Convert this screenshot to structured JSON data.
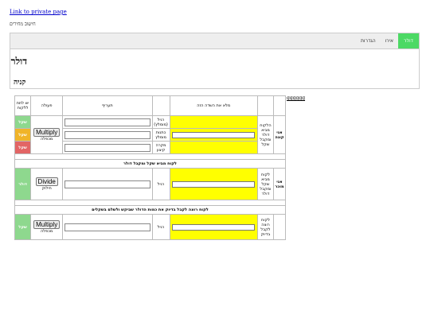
{
  "link_text": "Link to private page",
  "calc_title": "חישוב מחירים",
  "tabs": {
    "dollar": "דולר",
    "euro": "אירו",
    "settings": "הגדרות"
  },
  "panel": {
    "title": "דולר",
    "subtitle": "קניה"
  },
  "extra_link": "gggggg",
  "table": {
    "headers": {
      "enter": "מלא את השדה הזה",
      "desc": "תעריף",
      "action": "פעולה",
      "has": "יש לתת ללקוח"
    },
    "buy": {
      "role": "אני קונה",
      "client": "הלקוח מביא דולר ומקבל שקל",
      "rows": [
        {
          "label": "רגיל (מומלץ)",
          "btn": "",
          "sub": "",
          "cur": "שקל",
          "curColor": "#8ed88e"
        },
        {
          "label": "כתנות מומלץ",
          "btn": "Multiply",
          "sub": "מכפלה",
          "cur": "שקל",
          "curColor": "#f0b429"
        },
        {
          "label": "מקרה קיצון",
          "btn": "",
          "sub": "",
          "cur": "שקל",
          "curColor": "#e26565"
        }
      ]
    },
    "sec1": "לקוח מביא שקל ומקבל דולר",
    "sell": {
      "role": "אני מוכר",
      "client": "לקוח מביא שקל ומקבל דולר",
      "label": "רגיל",
      "btn": "Divide",
      "sub": "חילוק",
      "cur": "דולר",
      "curColor": "#8ed88e"
    },
    "sec2": "לקוח רוצה לקבל בדיוק את כמות הדולר שביקש ולשלם בשקלים",
    "exact": {
      "client": "לקוח רוצה לקבל בדיוק",
      "label": "רגיל",
      "btn": "Multiply",
      "sub": "מכפלה",
      "cur": "שקל",
      "curColor": "#8ed88e"
    }
  },
  "colors": {
    "accent": "#4cd964",
    "field": "#ffff00"
  }
}
